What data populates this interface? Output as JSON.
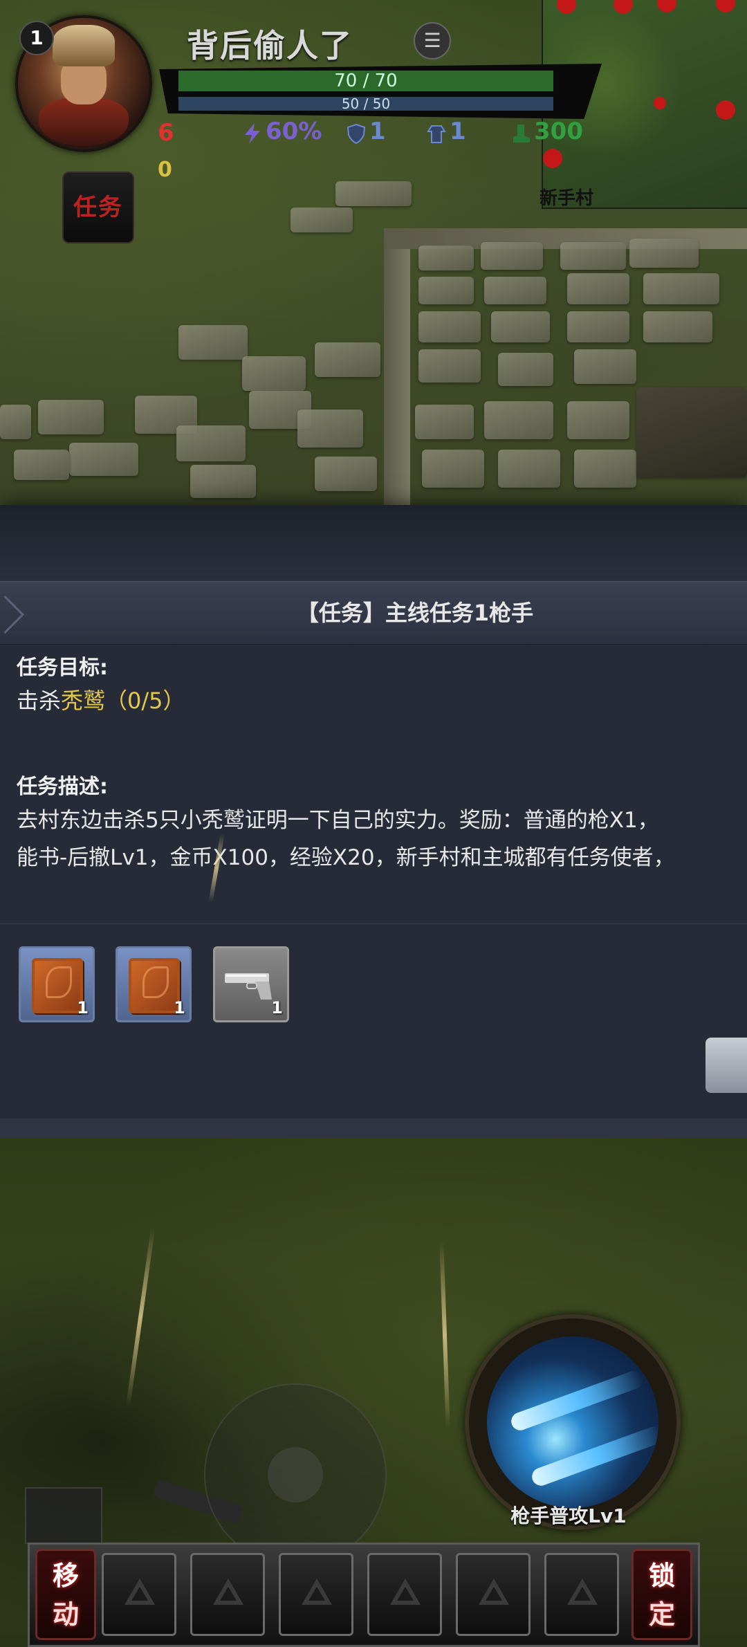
{
  "player": {
    "level": "1",
    "name": "背后偷人了",
    "hp": "70 / 70",
    "mp": "50  /  50"
  },
  "stats": {
    "red_value": "6",
    "yellow_value": "0",
    "speed": "60%",
    "defense": "1",
    "magic_resist": "1",
    "green_value": "300"
  },
  "task_button_label": "任务",
  "minimap": {
    "label": "新手村"
  },
  "dialog": {
    "title": "【任务】主线任务1枪手",
    "objective_label": "任务目标:",
    "objective_prefix": "击杀",
    "objective_target": "秃鹫",
    "objective_progress": "（0/5）",
    "description_label": "任务描述:",
    "description_line1": "去村东边击杀5只小秃鹫证明一下自己的实力。奖励：普通的枪X1，",
    "description_line2": "能书-后撤Lv1，金币X100，经验X20，新手村和主城都有任务使者，",
    "rewards": [
      {
        "icon": "skill-book-icon",
        "count": "1"
      },
      {
        "icon": "skill-book-icon",
        "count": "1"
      },
      {
        "icon": "pistol-icon",
        "count": "1"
      }
    ]
  },
  "skill": {
    "label": "枪手普攻Lv1"
  },
  "hotbar": {
    "left_label_top": "移",
    "left_label_bottom": "动",
    "right_label_top": "锁",
    "right_label_bottom": "定"
  },
  "colors": {
    "hp_bar": "#2c6a2c",
    "mp_bar": "#2d4560",
    "highlight": "#e6c84a",
    "dialog_bg": "#262b37"
  }
}
